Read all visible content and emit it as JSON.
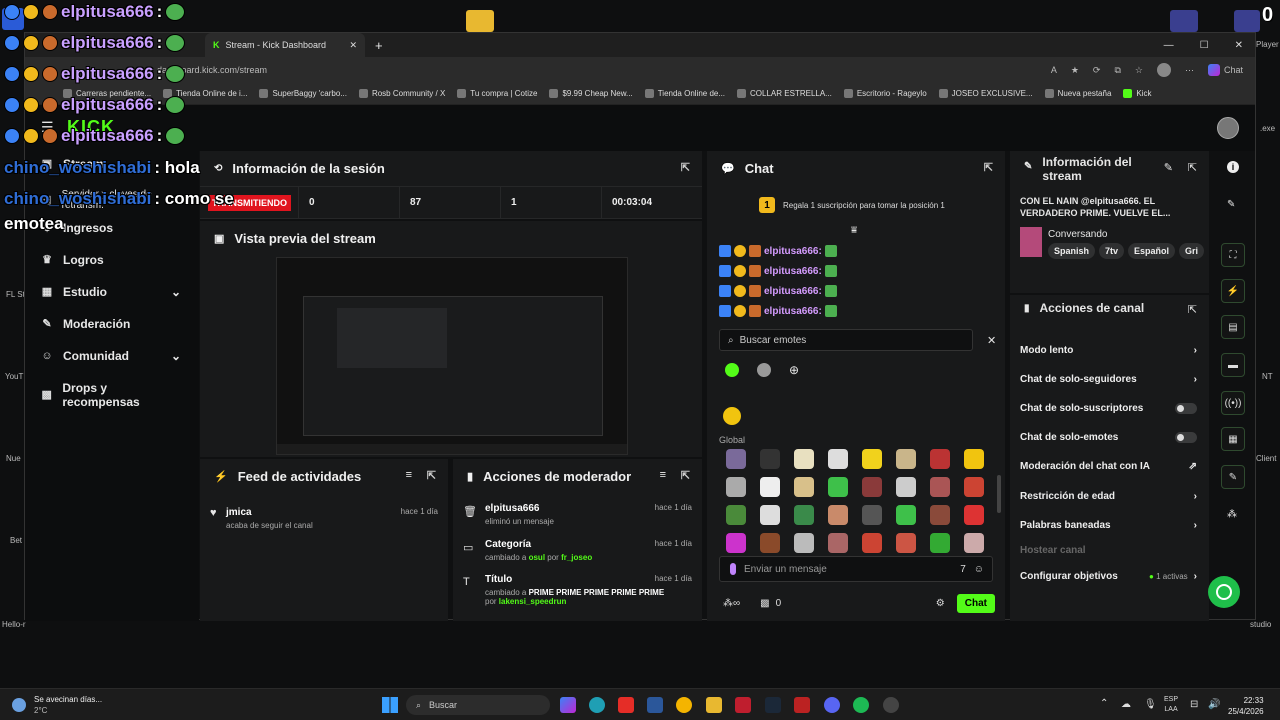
{
  "browser": {
    "tabs": [
      {
        "label": "Stream - Kick Dashboard",
        "active": true
      }
    ],
    "url": "dashboard.kick.com/stream",
    "profile_label": "Chat",
    "bookmarks": [
      "Carreras pendiente...",
      "Tienda Online de i...",
      "SuperBaggy 'carbo...",
      "Rosb Community / X",
      "Tu compra | Cotize",
      "$9.99 Cheap New...",
      "Tienda Online de...",
      "COLLAR ESTRELLA...",
      "Escritorio - Rageylo",
      "JOSEO EXCLUSIVE...",
      "Nueva pestaña",
      "Kick"
    ]
  },
  "overlay": {
    "lines": [
      {
        "user": "elpitusa666",
        "text": ":"
      },
      {
        "user": "elpitusa666",
        "text": ":"
      },
      {
        "user": "elpitusa666",
        "text": ":"
      },
      {
        "user": "elpitusa666",
        "text": ":"
      },
      {
        "user": "elpitusa666",
        "text": ":"
      }
    ],
    "chino_line1": "chino_woshishabi",
    "chino_text1": ": hola",
    "chino_line2": "chino_woshishabi",
    "chino_text2": ": como se",
    "chino_text3": "emotea",
    "top_right_count": "0"
  },
  "sidebar": {
    "logo": "KICK",
    "items": [
      {
        "label": "Stream",
        "icon": "stream-icon"
      },
      {
        "label": "Servidor y claves de retransm.",
        "icon": "server-icon"
      },
      {
        "label": "Ingresos",
        "icon": "money-icon"
      },
      {
        "label": "Logros",
        "icon": "trophy-icon"
      },
      {
        "label": "Estudio",
        "icon": "studio-icon",
        "expand": true
      },
      {
        "label": "Moderación",
        "icon": "wrench-icon"
      },
      {
        "label": "Comunidad",
        "icon": "community-icon",
        "expand": true
      },
      {
        "label": "Drops y recompensas",
        "icon": "gift-icon"
      }
    ]
  },
  "session": {
    "title": "Información de la sesión",
    "status": "TRANSMITIENDO",
    "stats": [
      "0",
      "87",
      "1",
      "00:03:04"
    ]
  },
  "preview": {
    "title": "Vista previa del stream"
  },
  "feed": {
    "title": "Feed de actividades",
    "items": [
      {
        "user": "jmica",
        "action": "acaba de seguir el canal",
        "time": "hace 1 día"
      }
    ]
  },
  "mod_actions": {
    "title": "Acciones de moderador",
    "items": [
      {
        "title": "elpitusa666",
        "desc": "eliminó un mensaje",
        "time": "hace 1 día"
      },
      {
        "title": "Categoría",
        "desc_prefix": "cambiado a",
        "from": "osul",
        "by": "por",
        "user": "fr_joseo",
        "time": "hace 1 día"
      },
      {
        "title": "Título",
        "desc_prefix": "cambiado a",
        "value": "PRIME PRIME PRIME PRIME PRIME",
        "by": "por",
        "user": "lakensi_speedrun",
        "time": "hace 1 día"
      }
    ]
  },
  "chat": {
    "title": "Chat",
    "sub_prompt": "Regala 1 suscripción para tomar la posición 1",
    "messages": [
      "elpitusa666:",
      "elpitusa666:",
      "elpitusa666:",
      "elpitusa666:"
    ],
    "search_placeholder": "Buscar emotes",
    "global_label": "Global",
    "input_placeholder": "Enviar un mensaje",
    "viewers": "0",
    "send_label": "Chat"
  },
  "stream_info": {
    "title": "Información del stream",
    "stream_title": "CON EL NAIN @elpitusa666. EL VERDADERO PRIME. VUELVE EL...",
    "category": "Conversando",
    "tags": [
      "Spanish",
      "7tv",
      "Español",
      "Gri"
    ]
  },
  "channel_actions": {
    "title": "Acciones de canal",
    "rows": [
      {
        "label": "Modo lento",
        "control": "chevron"
      },
      {
        "label": "Chat de solo-seguidores",
        "control": "chevron"
      },
      {
        "label": "Chat de solo-suscriptores",
        "control": "toggle"
      },
      {
        "label": "Chat de solo-emotes",
        "control": "toggle"
      },
      {
        "label": "Moderación del chat con IA",
        "control": "external"
      },
      {
        "label": "Restricción de edad",
        "control": "chevron"
      },
      {
        "label": "Palabras baneadas",
        "control": "chevron"
      },
      {
        "label": "Hostear canal",
        "control": "none"
      },
      {
        "label": "Configurar objetivos",
        "control": "chevron",
        "status": "1 activas"
      }
    ]
  },
  "taskbar": {
    "weather_title": "Se avecinan días...",
    "weather_temp": "2°C",
    "search": "Buscar",
    "lang1": "ESP",
    "lang2": "LAA",
    "time": "22:33",
    "date": "25/4/2026"
  },
  "desktop_labels": [
    "FL St",
    "YouT",
    "Nue",
    "Bet",
    "Hello-r",
    "Player",
    ".exe",
    "Client",
    "NT",
    "studio"
  ],
  "colors": {
    "accent": "#53fc18",
    "live": "#e0141e",
    "panel": "#18191a"
  }
}
